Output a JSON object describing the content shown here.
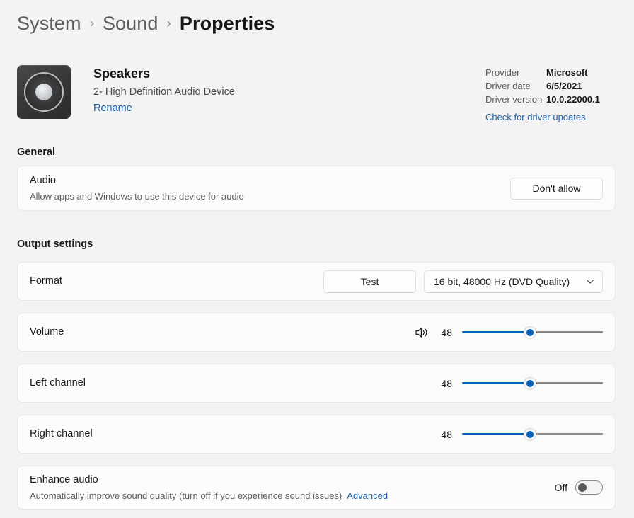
{
  "breadcrumb": {
    "root": "System",
    "parent": "Sound",
    "current": "Properties",
    "separator": "›"
  },
  "device": {
    "icon": "speaker-device-icon",
    "name": "Speakers",
    "subtitle": "2- High Definition Audio Device",
    "rename_label": "Rename"
  },
  "driver": {
    "provider_label": "Provider",
    "provider_value": "Microsoft",
    "date_label": "Driver date",
    "date_value": "6/5/2021",
    "version_label": "Driver version",
    "version_value": "10.0.22000.1",
    "update_link": "Check for driver updates"
  },
  "general": {
    "heading": "General",
    "audio": {
      "title": "Audio",
      "subtitle": "Allow apps and Windows to use this device for audio",
      "button_label": "Don't allow"
    }
  },
  "output_settings": {
    "heading": "Output settings",
    "format": {
      "title": "Format",
      "test_label": "Test",
      "selected_option": "16 bit, 48000 Hz (DVD Quality)",
      "chevron": "chevron-down-icon"
    },
    "volume": {
      "title": "Volume",
      "icon": "speaker-volume-icon",
      "value": "48",
      "percent": 48
    },
    "left_channel": {
      "title": "Left channel",
      "value": "48",
      "percent": 48
    },
    "right_channel": {
      "title": "Right channel",
      "value": "48",
      "percent": 48
    },
    "enhance_audio": {
      "title": "Enhance audio",
      "subtitle": "Automatically improve sound quality (turn off if you experience sound issues)",
      "advanced_link": "Advanced",
      "toggle_state": "Off"
    }
  },
  "colors": {
    "accent": "#005fb8",
    "link": "#1f5fa8",
    "page_bg": "#f3f3f3",
    "card_bg": "#fbfbfb",
    "track_rest": "#868686"
  }
}
